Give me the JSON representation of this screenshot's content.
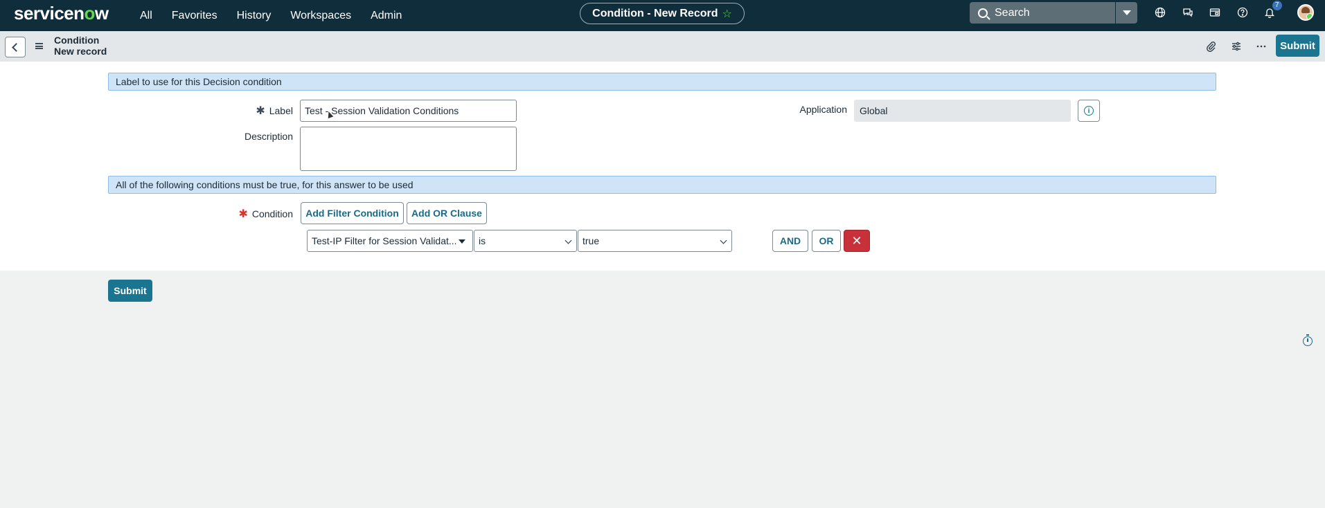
{
  "topnav": {
    "logo_text_a": "servicen",
    "logo_text_o": "o",
    "logo_text_b": "w",
    "links": [
      "All",
      "Favorites",
      "History",
      "Workspaces",
      "Admin"
    ],
    "record_title": "Condition - New Record",
    "search_placeholder": "Search",
    "notification_count": "7",
    "icons": [
      "globe-icon",
      "chat-icon",
      "id-card-icon",
      "help-icon",
      "bell-icon"
    ]
  },
  "header": {
    "title": "Condition",
    "subtitle": "New record",
    "submit_label": "Submit",
    "icons": [
      "paperclip-icon",
      "sliders-icon",
      "more-icon"
    ]
  },
  "form": {
    "section1": "Label to use for this Decision condition",
    "label_field": {
      "label": "Label",
      "value": "Test - Session Validation Conditions"
    },
    "description_field": {
      "label": "Description",
      "value": ""
    },
    "application_field": {
      "label": "Application",
      "value": "Global"
    },
    "section2": "All of the following conditions must be true, for this answer to be used",
    "condition": {
      "label": "Condition",
      "add_filter_label": "Add Filter Condition",
      "add_or_label": "Add OR Clause",
      "field_value": "Test-IP Filter for Session Validat...",
      "operator_value": "is",
      "value_value": "true",
      "and_label": "AND",
      "or_label": "OR"
    },
    "submit_label": "Submit"
  },
  "colors": {
    "nav_bg": "#0f2d3b",
    "accent": "#1b7590",
    "logo_green": "#62d84e",
    "section_bg": "#cfe4f7",
    "delete_red": "#c8313a"
  }
}
